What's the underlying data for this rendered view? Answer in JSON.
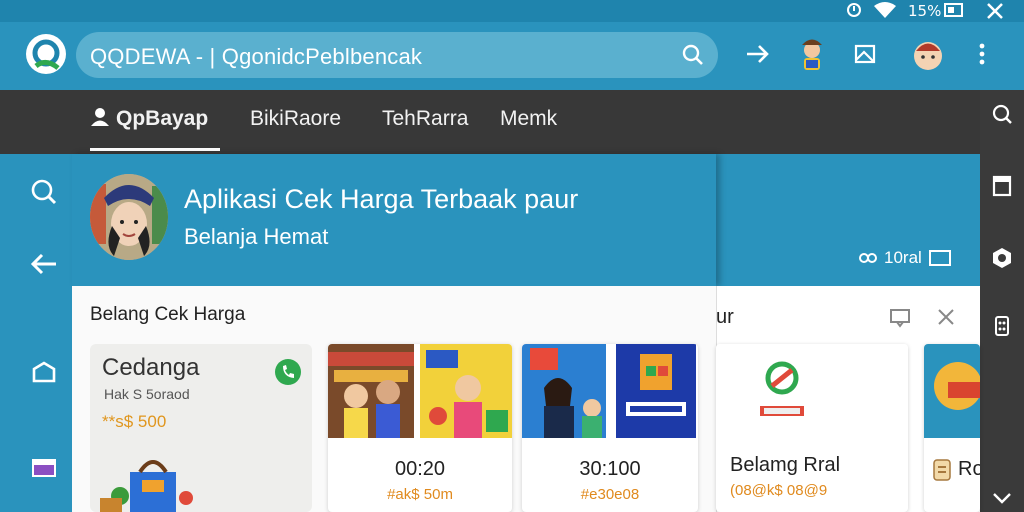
{
  "status_bar": {
    "battery": "15%",
    "icons": [
      "alarm-icon",
      "wifi-icon",
      "battery-icon",
      "close-icon"
    ]
  },
  "app_bar": {
    "search_text": "QQDEWA - | QgonidcPeblbencak",
    "icons": [
      "search-icon",
      "share-arrow-icon",
      "mascot-icon",
      "image-edit-icon",
      "profile-avatar-icon",
      "more-vert-icon"
    ]
  },
  "tabs": [
    {
      "label": "QpBayap",
      "active": true
    },
    {
      "label": "BikiRaore",
      "active": false
    },
    {
      "label": "TehRarra",
      "active": false
    },
    {
      "label": "Memk",
      "active": false
    }
  ],
  "hero": {
    "title": "Aplikasi Cek Harga Terbaak paur",
    "subtitle": "Belanja Hemat",
    "meta": "10ral"
  },
  "section": {
    "title": "Belang Cek Harga",
    "panel_label": "ur"
  },
  "featured": {
    "name": "Cedanga",
    "sub": "Hak S 5oraod",
    "price": "**s$ 500"
  },
  "cards": [
    {
      "value": "00:20",
      "price": "#ak$ 50m"
    },
    {
      "value": "30:100",
      "price": "#e30e08"
    },
    {
      "value": "Belamg Rral",
      "price": "(08@k$ 08@9"
    },
    {
      "value": "Ro",
      "price": ""
    }
  ],
  "colors": {
    "primary": "#2a93bd",
    "dark": "#383838",
    "accent": "#e08a1e"
  }
}
